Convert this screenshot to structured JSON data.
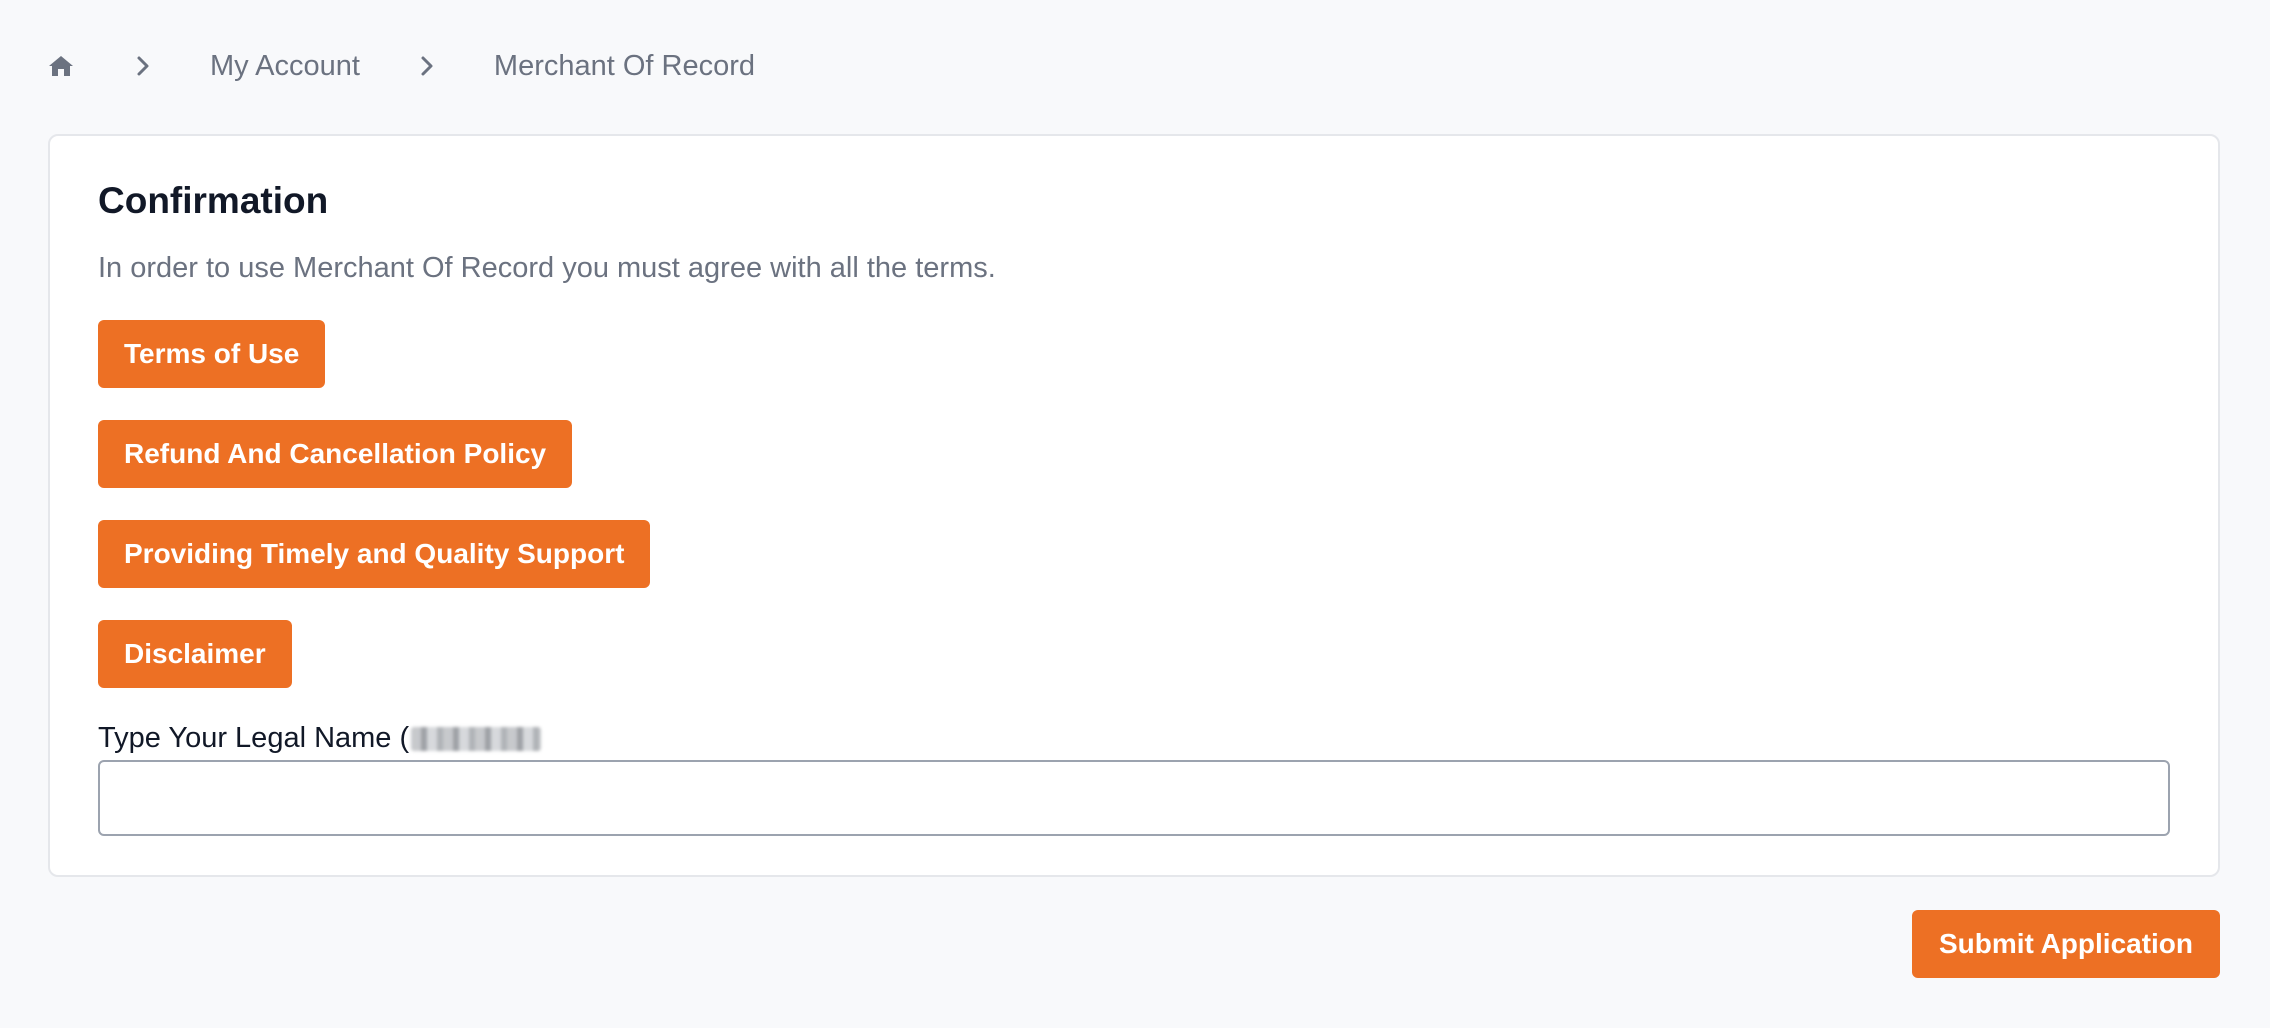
{
  "breadcrumb": {
    "home_icon": "home-icon",
    "separator_icon": "chevron-right-icon",
    "items": [
      {
        "label": "My Account"
      },
      {
        "label": "Merchant Of Record"
      }
    ]
  },
  "card": {
    "title": "Confirmation",
    "description": "In order to use Merchant Of Record you must agree with all the terms.",
    "terms_buttons": [
      {
        "label": "Terms of Use"
      },
      {
        "label": "Refund And Cancellation Policy"
      },
      {
        "label": "Providing Timely and Quality Support"
      },
      {
        "label": "Disclaimer"
      }
    ],
    "legal_name": {
      "label": "Type Your Legal Name (",
      "value": "",
      "placeholder": ""
    }
  },
  "submit": {
    "label": "Submit Application"
  },
  "colors": {
    "accent": "#ed7024",
    "background": "#f8f9fb",
    "muted_text": "#6b7280",
    "heading_text": "#111827"
  }
}
